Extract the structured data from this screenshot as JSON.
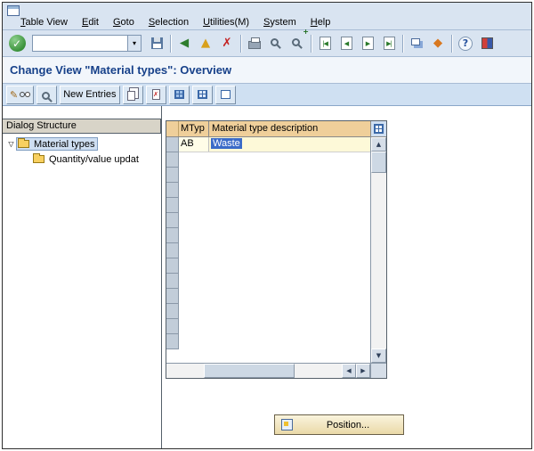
{
  "colors": {
    "toolbar_bg": "#d9e4f1",
    "app_toolbar_bg": "#cfe0f2",
    "title_text": "#17418a",
    "table_header_bg": "#efcf9a",
    "selection_bg": "#3a6bc8",
    "row_selector_bg": "#c2cdd9",
    "tree_selected_bg": "#cfdff2",
    "position_button_bg": "#ead9a8"
  },
  "menu": {
    "items": [
      "Table View",
      "Edit",
      "Goto",
      "Selection",
      "Utilities(M)",
      "System",
      "Help"
    ]
  },
  "toolbar": {
    "command_value": ""
  },
  "title": "Change View \"Material types\": Overview",
  "app_toolbar": {
    "new_entries_label": "New Entries"
  },
  "sidebar": {
    "header": "Dialog Structure",
    "items": [
      {
        "label": "Material types",
        "selected": true
      },
      {
        "label": "Quantity/value updat",
        "selected": false
      }
    ]
  },
  "table": {
    "columns": [
      "MTyp",
      "Material type description"
    ],
    "rows": [
      {
        "mtyp": "AB",
        "description": "Waste",
        "selected": true
      }
    ]
  },
  "position_button": {
    "label": "Position..."
  },
  "icons": {
    "check": "✓",
    "dropdown": "▾",
    "back": "◀",
    "exit": "▲",
    "cancel": "✗",
    "find_plus": "+",
    "page_first": "|◀",
    "page_prev": "◀",
    "page_next": "▶",
    "page_last": "▶|",
    "shortcut": "◆",
    "help": "?",
    "pencil": "✎",
    "x_small": "✗",
    "tree_expanded": "▽",
    "scroll_up": "▲",
    "scroll_down": "▼",
    "scroll_left": "◀",
    "scroll_right": "▶"
  }
}
